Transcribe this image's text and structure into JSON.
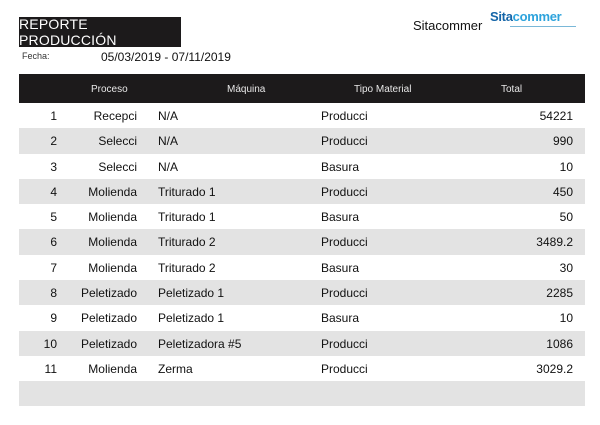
{
  "report": {
    "title": "REPORTE PRODUCCIÓN",
    "company": "Sitacommer",
    "logo": {
      "part1": "Sita",
      "part2": "commer"
    },
    "date_label": "Fecha:",
    "date_range": "05/03/2019 - 07/11/2019"
  },
  "table": {
    "headers": {
      "proceso": "Proceso",
      "maquina": "Máquina",
      "tipo": "Tipo Material",
      "total": "Total"
    },
    "rows": [
      {
        "n": "1",
        "proceso": "Recepci",
        "maquina": "N/A",
        "tipo": "Producci",
        "total": "54221"
      },
      {
        "n": "2",
        "proceso": "Selecci",
        "maquina": "N/A",
        "tipo": "Producci",
        "total": "990"
      },
      {
        "n": "3",
        "proceso": "Selecci",
        "maquina": "N/A",
        "tipo": "Basura",
        "total": "10"
      },
      {
        "n": "4",
        "proceso": "Molienda",
        "maquina": "Triturado 1",
        "tipo": "Producci",
        "total": "450"
      },
      {
        "n": "5",
        "proceso": "Molienda",
        "maquina": "Triturado 1",
        "tipo": "Basura",
        "total": "50"
      },
      {
        "n": "6",
        "proceso": "Molienda",
        "maquina": "Triturado 2",
        "tipo": "Producci",
        "total": "3489.2"
      },
      {
        "n": "7",
        "proceso": "Molienda",
        "maquina": "Triturado 2",
        "tipo": "Basura",
        "total": "30"
      },
      {
        "n": "8",
        "proceso": "Peletizado",
        "maquina": "Peletizado 1",
        "tipo": "Producci",
        "total": "2285"
      },
      {
        "n": "9",
        "proceso": "Peletizado",
        "maquina": "Peletizado 1",
        "tipo": "Basura",
        "total": "10"
      },
      {
        "n": "10",
        "proceso": "Peletizado",
        "maquina": "Peletizadora #5",
        "tipo": "Producci",
        "total": "1086"
      },
      {
        "n": "11",
        "proceso": "Molienda",
        "maquina": "Zerma",
        "tipo": "Producci",
        "total": "3029.2"
      }
    ]
  }
}
